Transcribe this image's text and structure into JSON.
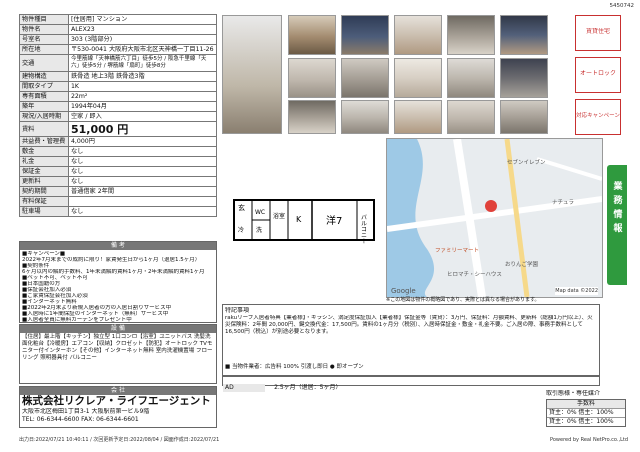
{
  "doc_id": "5450742",
  "spec": [
    {
      "k": "物件種目",
      "v": "[住居用] マンション"
    },
    {
      "k": "物件名",
      "v": "ALEX23"
    },
    {
      "k": "号室名",
      "v": "303 (3階部分)"
    },
    {
      "k": "所在地",
      "v": "〒530-0041 大阪府大阪市北区天神橋一丁目11-26"
    },
    {
      "k": "交通",
      "v": "今里筋線「天神橋筋六丁目」徒歩5分 / 阪急千里線「天六」徒歩5分 / 堺筋線「扇町」徒歩8分"
    },
    {
      "k": "建物構造",
      "v": "鉄骨造 地上3階 鉄骨造3階"
    },
    {
      "k": "間取タイプ",
      "v": "1K"
    },
    {
      "k": "専有面積",
      "v": "22m²"
    },
    {
      "k": "築年",
      "v": "1994年04月"
    },
    {
      "k": "現況/入居時期",
      "v": "空家 / 即入"
    },
    {
      "k": "賃料",
      "v": "51,000 円"
    },
    {
      "k": "共益費・管理費",
      "v": "4,000円"
    },
    {
      "k": "敷金",
      "v": "なし"
    },
    {
      "k": "礼金",
      "v": "なし"
    },
    {
      "k": "保証金",
      "v": "なし"
    },
    {
      "k": "更新料",
      "v": "なし"
    },
    {
      "k": "契約期間",
      "v": "普通借家 2年間"
    },
    {
      "k": "有料保証",
      "v": ""
    },
    {
      "k": "駐車場",
      "v": "なし"
    }
  ],
  "spec_extra": {
    "balcony_k": "開口部方位",
    "balcony_v": "",
    "deposit_k": "償却・敷引",
    "deposit_v": "なし"
  },
  "bikou_title": "備 考",
  "bikou": [
    "■キャンペーン■",
    "2022年7月末までの成約に限り！家賃発生日から1ヶ月（退居1.5ヶ月）",
    "",
    "■契約条件",
    "6ヶ月以内の解約手数料、1年未満解約賃料1ヶ月・2年未満解約賃料1ヶ月",
    "■ペット不可、ペット不可",
    "■日本国籍の方",
    "■保証会社加入必須",
    "■ご家賃保証会社加入必須",
    "■インターネット無料",
    "■2022年2月末より新規入居者の方の入居日割りサービス中",
    "■入居時に1年間保証のインターネット（無料）サービス中",
    "■入居者全員に無料カーテンをプレゼント中"
  ],
  "setsubi_title": "設 備",
  "setsubi": "【住居】最上階【キッチン】独立型 1口コンロ【浴室】ユニットバス 洗髪洗面化粧台【冷暖房】エアコン【収納】クロゼット【防犯】オートロック TVモニター付インターホン【その他】インターネット無料 室内洗濯機置場 フローリング 照明器具付 バルコニー",
  "kaisha_title": "会 社",
  "company_name": "株式会社リクレア・ライフエージェント",
  "company_addr": "大阪市北区梅田1丁目3-1 大阪駅前第一ビル9階",
  "company_tel": "TEL: 06-6344-6600  FAX: 06-6344-6601",
  "footer_left": "出力日:2022/07/21 10:40:11 / 次回更新予定日:2022/08/04 / 図面作成日:2022/07/21",
  "footer_right": "Powered by Real NetPro.co.,Ltd",
  "floorplan": {
    "room": "洋7",
    "labels": [
      "玄",
      "WC",
      "浴室",
      "K",
      "冷",
      "洗",
      "収",
      "バルコニー"
    ]
  },
  "map_note": "※この地図は物件の概略図であり、実際とは異なる場合があります。",
  "map_labels": [
    "Map data ©2022",
    "ファミリーマート",
    "セブンイレブン",
    "ヒロマチ・シーハウス",
    "おりんご学園",
    "ナチュラ",
    "Google"
  ],
  "badges": [
    {
      "label": "賃貸住宅",
      "color": "#2a7a3a"
    },
    {
      "label": "オートロック",
      "color": "#c83030"
    },
    {
      "label": "対応キャンペーン",
      "color": "#c83030"
    }
  ],
  "side_tab": "業務情報",
  "comment_title": "特記事項",
  "comment": "rakuリーフ入居者特典【業者様】・キラシン、満足度保証加入【業者様】保証金等（賃貸）：3万円、保証料：月額賃料、更新料（総額1万円以上）、火災保険料：2年間 20,000円、鍵交換代金：17,500円。賃料の1ヶ月分（税別）、入居時保証金・敷金・礼金不要。ご入居の際、事務手数料として16,500円（税込）が別途必要となります。",
  "comment2": "■ 当物件業者：広告料 100% 引渡し即日 ● 即オープン",
  "agent_fee": {
    "title": "取引態様・専任媒介",
    "k": "手数料",
    "rows": [
      "貸主：0% 借主：100%",
      "貸主：0% 借主：100%"
    ]
  },
  "footer_small": [
    {
      "k": "AD",
      "v": "2.5ヶ月（退居：5ヶ月）"
    }
  ]
}
